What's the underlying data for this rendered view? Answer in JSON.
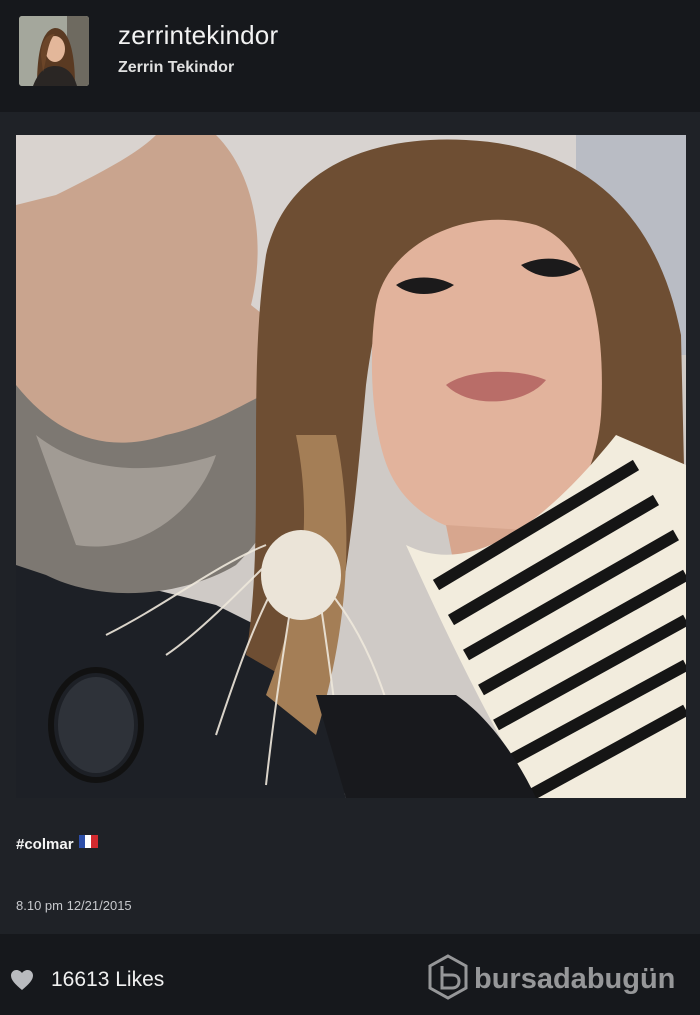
{
  "header": {
    "username": "zerrintekindor",
    "full_name": "Zerrin Tekindor",
    "avatar_icon": "profile-avatar"
  },
  "post": {
    "image_alt_icon": "selfie-photo",
    "caption": "#colmar",
    "caption_flag": "french-flag-icon",
    "timestamp": "8.10 pm 12/21/2015"
  },
  "footer": {
    "likes_count": "16613",
    "likes_label": "Likes",
    "heart_icon": "heart-icon",
    "watermark_text": "bursadabugün"
  },
  "colors": {
    "background": "#1f2227",
    "bar": "#16181c",
    "text": "#f0f0f0",
    "flag_blue": "#2d4ea8",
    "flag_white": "#ffffff",
    "flag_red": "#d32a2f"
  }
}
